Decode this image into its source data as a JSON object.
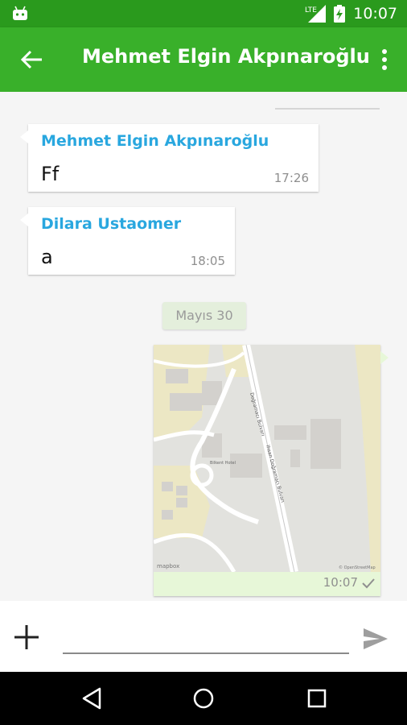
{
  "status_bar": {
    "time": "10:07",
    "network": "LTE"
  },
  "app_bar": {
    "title": "Mehmet Elgin Akpınaroğlu"
  },
  "messages": [
    {
      "sender": "Mehmet Elgin Akpınaroğlu",
      "text": "Ff",
      "time": "17:26"
    },
    {
      "sender": "Dilara Ustaomer",
      "text": "a",
      "time": "18:05"
    }
  ],
  "date_divider": "Mayıs 30",
  "outgoing": {
    "time": "10:07",
    "map_labels": {
      "street1": "Doğramacı Bulvarı",
      "street2": "Ihsan Doğramacı Bulvarı",
      "building": "Bilkent Hotel",
      "attribution": "© OpenStreetMap",
      "logo": "mapbox"
    }
  },
  "input": {
    "placeholder": ""
  },
  "colors": {
    "status_bar": "#2a9a1d",
    "app_bar": "#39b02a",
    "sender_name": "#29a7df",
    "outgoing_bubble": "#e7f7d8"
  }
}
